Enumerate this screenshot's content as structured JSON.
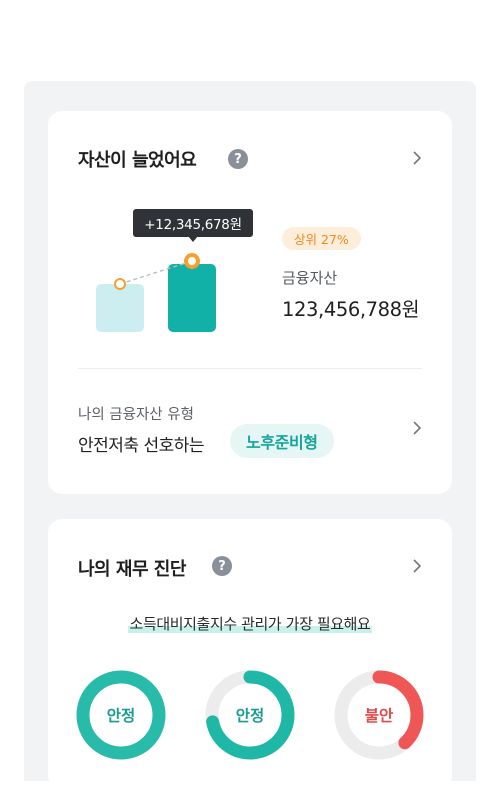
{
  "asset_card": {
    "title": "자산이 늘었어요",
    "help_icon": "?",
    "tooltip": "+12,345,678원",
    "rank_badge": "상위 27%",
    "asset_label": "금융자산",
    "asset_value": "123,456,788원",
    "type_label": "나의 금융자산 유형",
    "type_value": "안전저축 선호하는",
    "type_chip": "노후준비형"
  },
  "diagnosis_card": {
    "title": "나의 재무 진단",
    "help_icon": "?",
    "summary": "소득대비지출지수 관리가 가장 필요해요",
    "rings": [
      {
        "label": "안정",
        "level": 1.0,
        "color": "#1fb8a7",
        "text_color": "#1a9c8f"
      },
      {
        "label": "안정",
        "level": 0.72,
        "color": "#1fb8a7",
        "text_color": "#1a9c8f"
      },
      {
        "label": "불안",
        "level": 0.38,
        "color": "#ef5757",
        "text_color": "#e14a4a"
      }
    ]
  },
  "colors": {
    "accent": "#12b1a6",
    "warning": "#f2891f",
    "danger": "#ef5757"
  }
}
